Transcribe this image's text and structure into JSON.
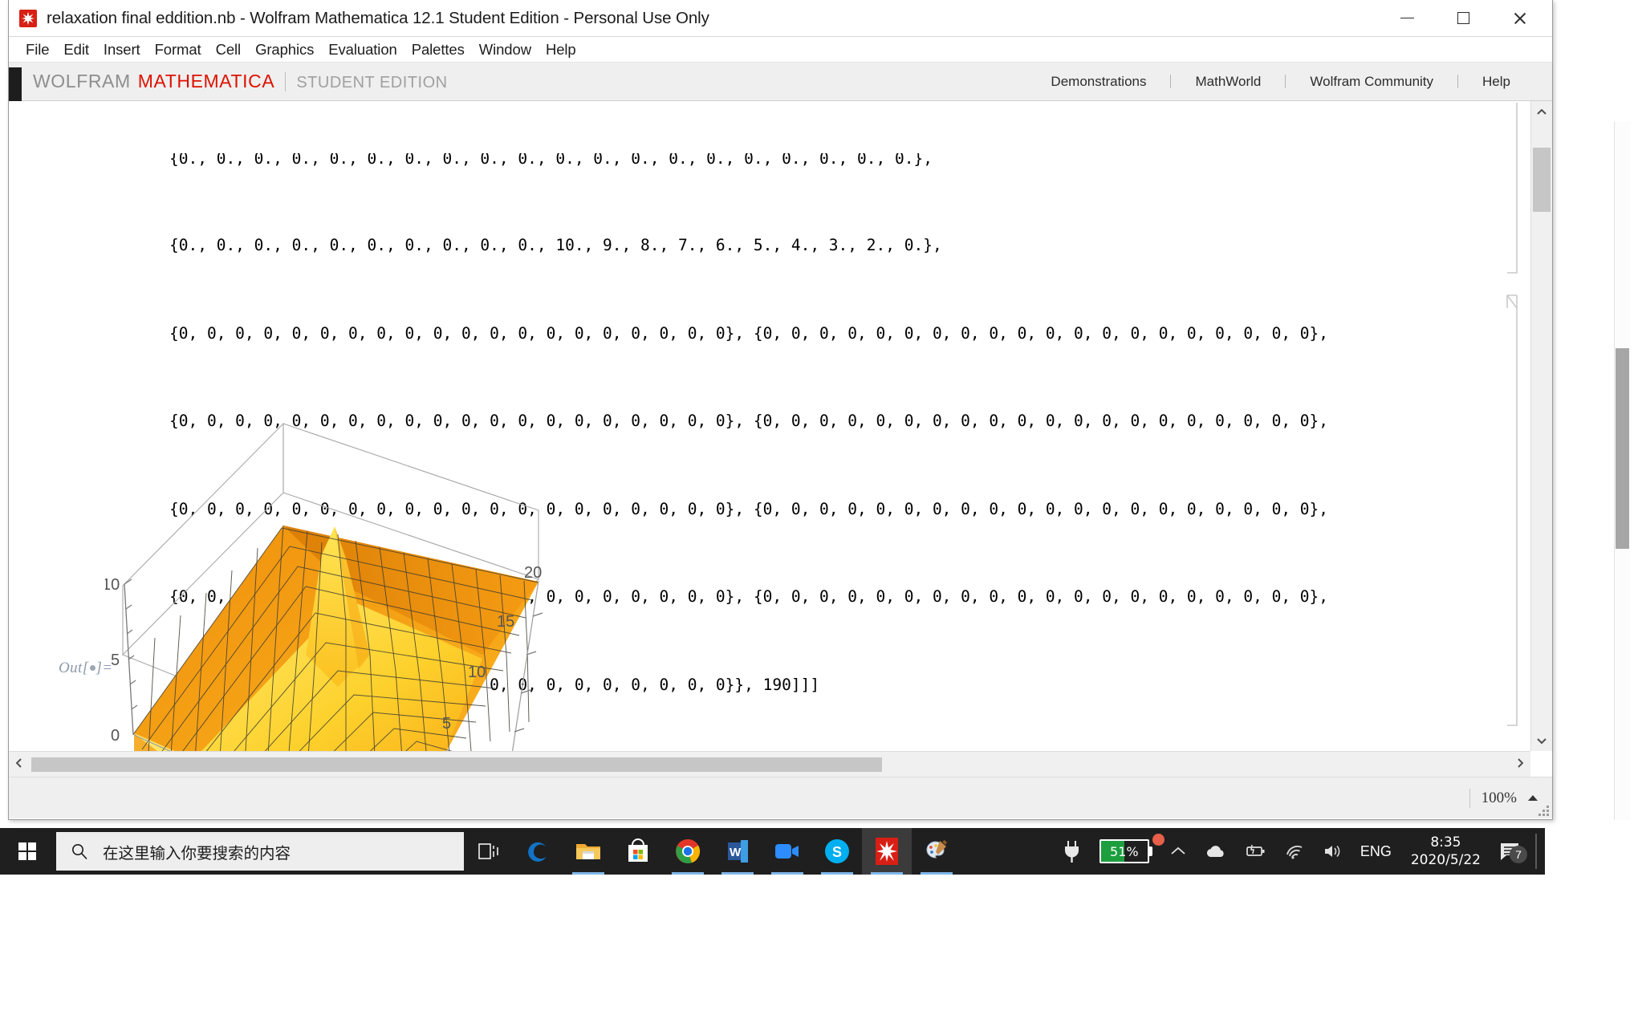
{
  "window": {
    "title": "relaxation final eddition.nb - Wolfram Mathematica 12.1 Student Edition - Personal Use Only",
    "app_icon": "mathematica-spikey-icon",
    "controls": {
      "minimize": "minimize-icon",
      "maximize": "maximize-icon",
      "close": "close-icon"
    }
  },
  "menu": {
    "items": [
      "File",
      "Edit",
      "Insert",
      "Format",
      "Cell",
      "Graphics",
      "Evaluation",
      "Palettes",
      "Window",
      "Help"
    ]
  },
  "toolbar": {
    "brand_wolfram": "WOLFRAM",
    "brand_product": "MATHEMATICA",
    "brand_edition": "STUDENT EDITION",
    "links": [
      "Demonstrations",
      "MathWorld",
      "Wolfram Community",
      "Help"
    ],
    "accent_red": "#dd1100",
    "gray": "#8e8e8e"
  },
  "notebook": {
    "output_label": "Out[",
    "output_label_end": "]=",
    "code_lines": [
      "{0., 0., 0., 0., 0., 0., 0., 0., 0., 0., 0., 0., 0., 0., 0., 0., 0., 0., 0., 0.},",
      "{0., 0., 0., 0., 0., 0., 0., 0., 0., 0., 10., 9., 8., 7., 6., 5., 4., 3., 2., 0.},",
      "{0, 0, 0, 0, 0, 0, 0, 0, 0, 0, 0, 0, 0, 0, 0, 0, 0, 0, 0, 0}, {0, 0, 0, 0, 0, 0, 0, 0, 0, 0, 0, 0, 0, 0, 0, 0, 0, 0, 0, 0},",
      "{0, 0, 0, 0, 0, 0, 0, 0, 0, 0, 0, 0, 0, 0, 0, 0, 0, 0, 0, 0}, {0, 0, 0, 0, 0, 0, 0, 0, 0, 0, 0, 0, 0, 0, 0, 0, 0, 0, 0, 0},",
      "{0, 0, 0, 0, 0, 0, 0, 0, 0, 0, 0, 0, 0, 0, 0, 0, 0, 0, 0, 0}, {0, 0, 0, 0, 0, 0, 0, 0, 0, 0, 0, 0, 0, 0, 0, 0, 0, 0, 0, 0},",
      "{0, 0, 0, 0, 0, 0, 0, 0, 0, 0, 0, 0, 0, 0, 0, 0, 0, 0, 0, 0}, {0, 0, 0, 0, 0, 0, 0, 0, 0, 0, 0, 0, 0, 0, 0, 0, 0, 0, 0, 0},",
      "{0, 0, 0, 0, 0, 0, 0, 0, 0, 0, 0, 0, 0, 0, 0, 0, 0, 0, 0, 0}}, 190]]]"
    ]
  },
  "chart_data": {
    "type": "surface3d",
    "title": "",
    "xlabel": "",
    "ylabel": "",
    "zlabel": "",
    "x_ticks": [
      5,
      10,
      15
    ],
    "y_ticks": [
      5,
      10,
      15,
      20
    ],
    "z_ticks": [
      0,
      5,
      10
    ],
    "zlim": [
      0,
      10
    ],
    "xlim": [
      0,
      20
    ],
    "ylim": [
      0,
      20
    ],
    "grid": true,
    "mesh": true,
    "colors": {
      "low": "#f59a12",
      "mid": "#fbb522",
      "high": "#ffe14a",
      "mesh": "#3b3b33",
      "axis": "#6d6d6d"
    },
    "description": "ListPlot3D relaxation surface: flat orange plateau with a yellow ridge peaking near value 10 along a diagonal crease"
  },
  "status": {
    "zoom_level": "100%",
    "zoom_caret": "caret-up-icon",
    "resize_grip": "resize-grip-icon"
  },
  "scrollbars": {
    "up_arrow": "chevron-up-icon",
    "down_arrow": "chevron-down-icon",
    "left_arrow": "chevron-left-icon",
    "right_arrow": "chevron-right-icon"
  },
  "taskbar": {
    "start": "windows-logo-icon",
    "search_placeholder": "在这里输入你要搜索的内容",
    "search_icon": "search-icon",
    "icons": [
      {
        "name": "task-view-icon",
        "active": false,
        "open": false
      },
      {
        "name": "edge-icon",
        "active": false,
        "open": false
      },
      {
        "name": "file-explorer-icon",
        "active": false,
        "open": true
      },
      {
        "name": "microsoft-store-icon",
        "active": false,
        "open": false
      },
      {
        "name": "chrome-icon",
        "active": false,
        "open": true
      },
      {
        "name": "word-icon",
        "active": false,
        "open": true
      },
      {
        "name": "zoom-icon",
        "active": false,
        "open": true
      },
      {
        "name": "skype-icon",
        "active": false,
        "open": true
      },
      {
        "name": "mathematica-icon",
        "active": true,
        "open": true
      },
      {
        "name": "paint-icon",
        "active": false,
        "open": true
      }
    ],
    "tray": {
      "battery_percent": "51%",
      "battery_fill_color": "#1d9e3f",
      "plug_icon": "power-plug-icon",
      "overflow_icon": "chevron-up-icon",
      "onedrive_icon": "onedrive-cloud-icon",
      "battery_icon": "battery-charging-icon",
      "network_icon": "wifi-icon",
      "volume_icon": "speaker-icon",
      "language": "ENG",
      "time": "8:35",
      "date": "2020/5/22",
      "notification_icon": "notification-icon",
      "notification_count": "7"
    }
  }
}
